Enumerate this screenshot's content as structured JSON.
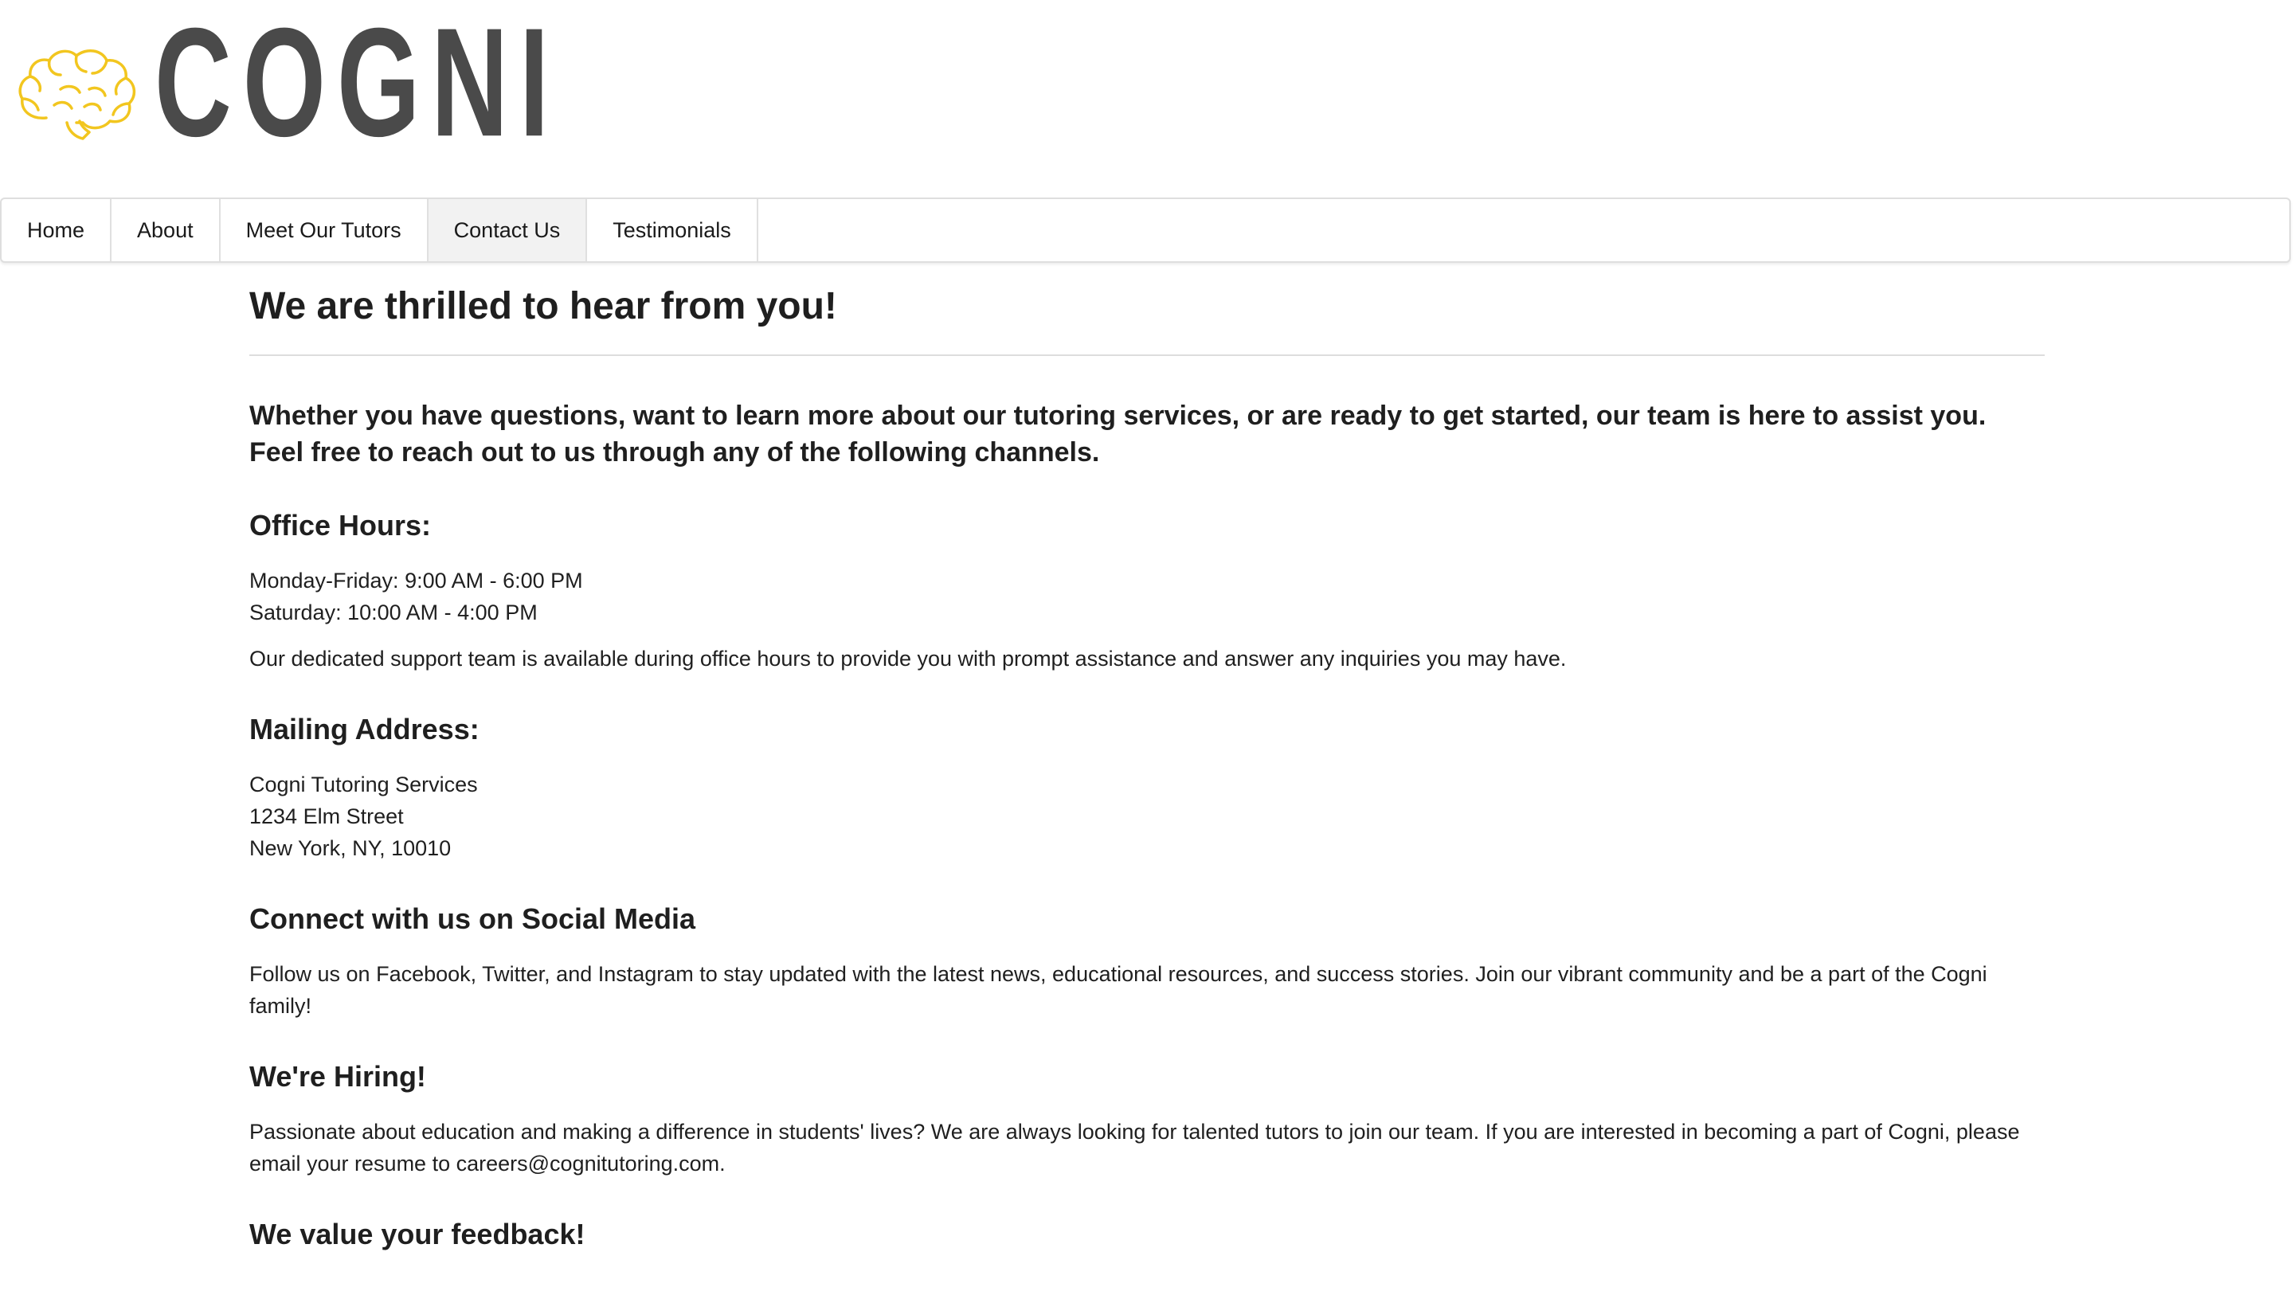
{
  "brand": {
    "name": "COGNI",
    "logo_icon": "brain-icon",
    "logo_color": "#f2c61f",
    "wordmark_color": "#4a4a4a"
  },
  "nav": {
    "items": [
      {
        "label": "Home",
        "active": false
      },
      {
        "label": "About",
        "active": false
      },
      {
        "label": "Meet Our Tutors",
        "active": false
      },
      {
        "label": "Contact Us",
        "active": true
      },
      {
        "label": "Testimonials",
        "active": false
      }
    ]
  },
  "main": {
    "title": "We are thrilled to hear from you!",
    "intro": "Whether you have questions, want to learn more about our tutoring services, or are ready to get started, our team is here to assist you. Feel free to reach out to us through any of the following channels.",
    "office_hours": {
      "heading": "Office Hours:",
      "weekday": "Monday-Friday: 9:00 AM - 6:00 PM",
      "saturday": "Saturday: 10:00 AM - 4:00 PM",
      "note": "Our dedicated support team is available during office hours to provide you with prompt assistance and answer any inquiries you may have."
    },
    "mailing": {
      "heading": "Mailing Address:",
      "line1": "Cogni Tutoring Services",
      "line2": "1234 Elm Street",
      "line3": "New York, NY, 10010"
    },
    "social": {
      "heading": "Connect with us on Social Media",
      "text": "Follow us on Facebook, Twitter, and Instagram to stay updated with the latest news, educational resources, and success stories. Join our vibrant community and be a part of the Cogni family!"
    },
    "hiring": {
      "heading": "We're Hiring!",
      "text": "Passionate about education and making a difference in students' lives? We are always looking for talented tutors to join our team. If you are interested in becoming a part of Cogni, please email your resume to careers@cognitutoring.com."
    },
    "feedback": {
      "heading": "We value your feedback!"
    }
  }
}
